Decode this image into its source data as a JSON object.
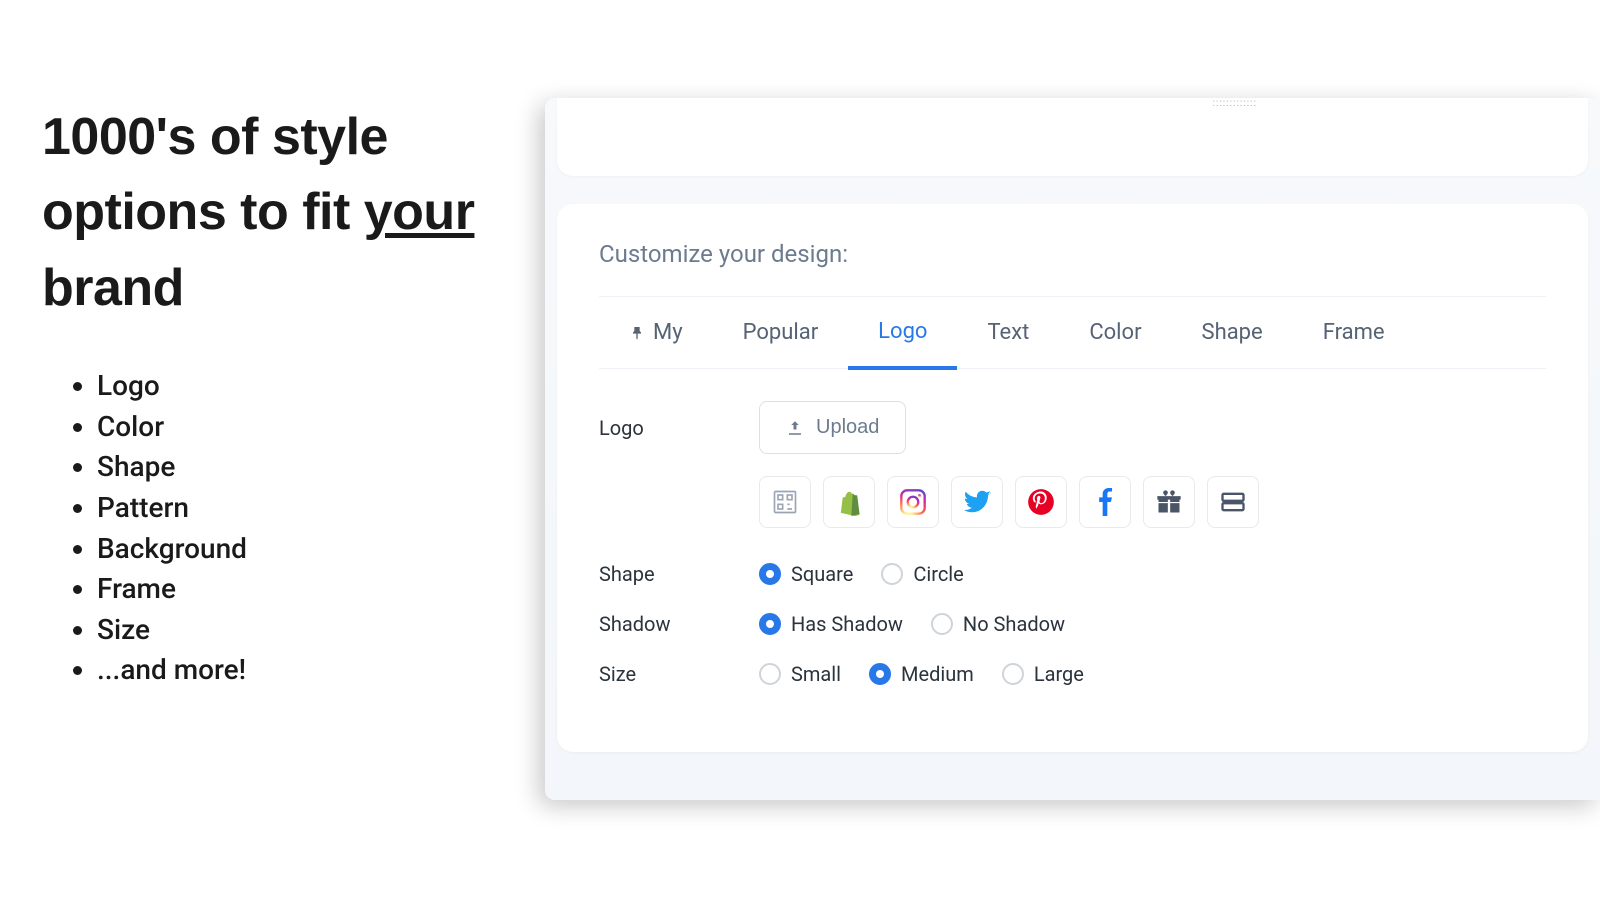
{
  "left": {
    "headline_p1": "1000's of style options to fit ",
    "headline_underlined": "your ",
    "headline_p2": "brand",
    "features": [
      "Logo",
      "Color",
      "Shape",
      "Pattern",
      "Background",
      "Frame",
      "Size",
      "...and more!"
    ]
  },
  "panel": {
    "title": "Customize your design:",
    "tabs": [
      {
        "label": "My",
        "pinned": true
      },
      {
        "label": "Popular"
      },
      {
        "label": "Logo",
        "active": true
      },
      {
        "label": "Text"
      },
      {
        "label": "Color"
      },
      {
        "label": "Shape"
      },
      {
        "label": "Frame"
      }
    ],
    "logo": {
      "label": "Logo",
      "upload_label": "Upload",
      "presets": [
        "qr",
        "shopify",
        "instagram",
        "twitter",
        "pinterest",
        "facebook",
        "gift",
        "layout"
      ]
    },
    "shape": {
      "label": "Shape",
      "options": [
        {
          "label": "Square",
          "selected": true
        },
        {
          "label": "Circle",
          "selected": false
        }
      ]
    },
    "shadow": {
      "label": "Shadow",
      "options": [
        {
          "label": "Has Shadow",
          "selected": true
        },
        {
          "label": "No Shadow",
          "selected": false
        }
      ]
    },
    "size": {
      "label": "Size",
      "options": [
        {
          "label": "Small",
          "selected": false
        },
        {
          "label": "Medium",
          "selected": true
        },
        {
          "label": "Large",
          "selected": false
        }
      ]
    }
  }
}
